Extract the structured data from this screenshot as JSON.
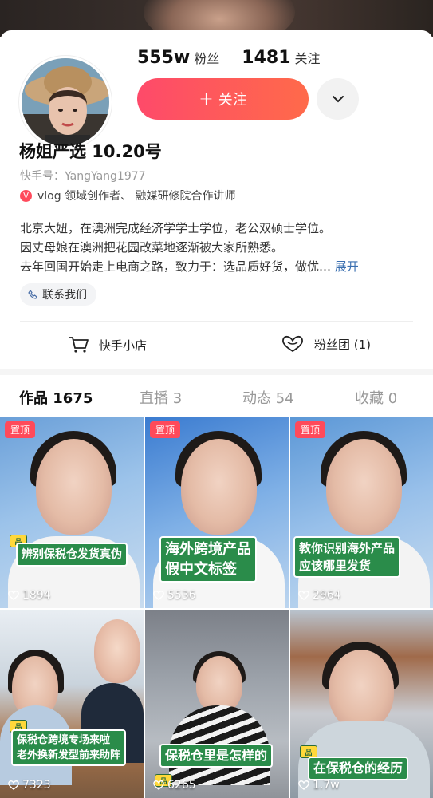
{
  "profile": {
    "fans_count": "555w",
    "fans_label": "粉丝",
    "following_count": "1481",
    "following_label": "关注",
    "follow_button": "关注",
    "follow_plus": "+",
    "name": "杨姐严选 10.20号",
    "kuaishou_id": "快手号：YangYang1977",
    "badge_mark": "V",
    "badge_text": "vlog 领域创作者、 融媒研修院合作讲师",
    "bio_lines": [
      "北京大妞，在澳洲完成经济学学士学位，老公双硕士学位。",
      "因丈母娘在澳洲把花园改菜地逐渐被大家所熟悉。",
      "去年回国开始走上电商之路，致力于：选品质好货，做优…"
    ],
    "bio_expand": "展开",
    "contact": "联系我们",
    "shop": "快手小店",
    "fan_group": "粉丝团 (1)"
  },
  "tabs": [
    {
      "label": "作品 1675"
    },
    {
      "label": "直播 3"
    },
    {
      "label": "动态 54"
    },
    {
      "label": "收藏 0"
    }
  ],
  "videos": [
    {
      "pinned": "置顶",
      "caption": "辨别保税仓发货真伪",
      "tag": "品",
      "likes": "1894"
    },
    {
      "pinned": "置顶",
      "caption_lines": [
        "海外跨境产品",
        "假中文标签"
      ],
      "likes": "5536"
    },
    {
      "pinned": "置顶",
      "caption_lines": [
        "教你识别海外产品",
        "应该哪里发货"
      ],
      "likes": "2964"
    },
    {
      "caption_lines": [
        "保税仓跨境专场来啦",
        "老外换新发型前来助阵"
      ],
      "tag": "品",
      "likes": "7323"
    },
    {
      "caption": "保税仓里是怎样的",
      "tag": "品",
      "likes": "6265"
    },
    {
      "caption": "在保税仓的经历",
      "tag": "品",
      "likes": "1.7w"
    }
  ],
  "colors": {
    "follow_gradient_start": "#fe4a6a",
    "follow_gradient_end": "#ff6a4a",
    "pinned_badge": "#ff4a5a",
    "caption_bg": "#2a8c4a",
    "expand_link": "#3a6fb0"
  }
}
